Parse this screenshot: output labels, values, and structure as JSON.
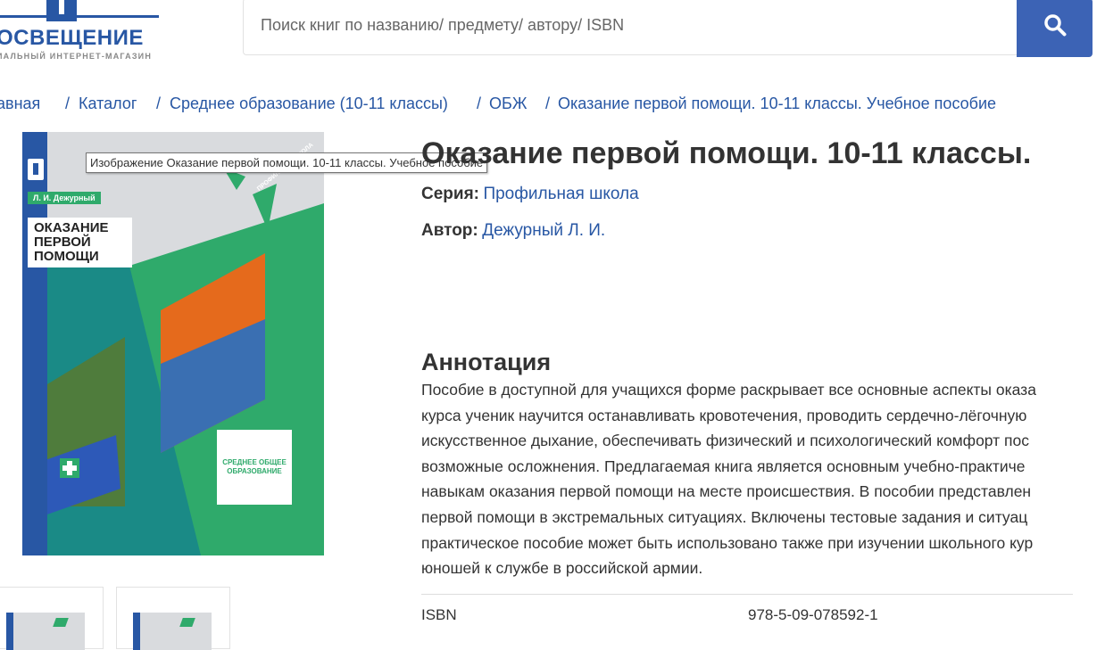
{
  "header": {
    "logo_title": "ОСВЕЩЕНИЕ",
    "logo_subtitle": "ИАЛЬНЫЙ ИНТЕРНЕТ-МАГАЗИН",
    "search_placeholder": "Поиск книг по названию/ предмету/ автору/ ISBN",
    "search_icon": "search-icon"
  },
  "breadcrumb": [
    "авная",
    "Каталог",
    "Среднее образование (10-11 классы)",
    "ОБЖ",
    "Оказание первой помощи. 10-11 классы. Учебное пособие"
  ],
  "breadcrumb_separator": "/",
  "cover": {
    "author": "Л. И. Дежурный",
    "title": "ОКАЗАНИЕ ПЕРВОЙ ПОМОЩИ",
    "profile": "ПРОФИЛЬНАЯ ШКОЛА",
    "edu_level": "СРЕДНЕЕ ОБЩЕЕ ОБРАЗОВАНИЕ"
  },
  "tooltip": "Изображение Оказание первой помощи. 10-11 классы. Учебное пособие",
  "book": {
    "title": "Оказание первой помощи. 10-11 классы.",
    "series_label": "Серия:",
    "series_value": "Профильная школа",
    "author_label": "Автор:",
    "author_value": "Дежурный Л. И."
  },
  "annotation": {
    "heading": "Аннотация",
    "lines": [
      "Пособие в доступной для учащихся форме раскрывает все основные аспекты оказа",
      "курса ученик научится останавливать кровотечения, проводить сердечно-лёгочную",
      "искусственное дыхание, обеспечивать физический и психологический комфорт пос",
      "возможные осложнения. Предлагаемая книга является основным учебно-практиче",
      "навыкам оказания первой помощи на месте происшествия. В пособии представлен",
      "первой помощи в экстремальных ситуациях. Включены тестовые задания и ситуац",
      "практическое пособие может быть использовано также при изучении школьного кур",
      "юношей к службе в российской армии."
    ]
  },
  "specs": {
    "isbn_label": "ISBN",
    "isbn_value": "978-5-09-078592-1"
  },
  "colors": {
    "brand_blue": "#2857a4",
    "search_button": "#3c63b5",
    "cover_green": "#2faa6b",
    "cover_teal": "#1a8a86"
  }
}
